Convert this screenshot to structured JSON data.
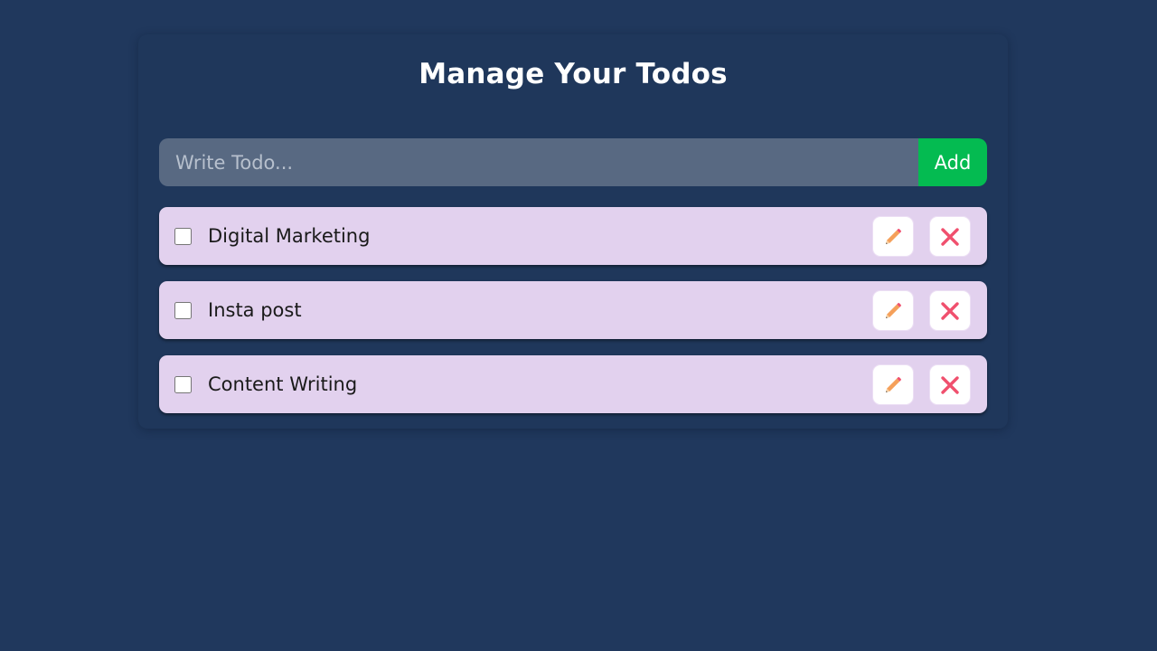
{
  "header": {
    "title": "Manage Your Todos"
  },
  "form": {
    "placeholder": "Write Todo...",
    "value": "",
    "add_label": "Add"
  },
  "todos": [
    {
      "text": "Digital Marketing",
      "completed": false
    },
    {
      "text": "Insta post",
      "completed": false
    },
    {
      "text": "Content Writing",
      "completed": false
    }
  ],
  "icons": {
    "edit": "pencil-icon",
    "delete": "close-icon"
  },
  "colors": {
    "background": "#20385d",
    "input_bg": "#586982",
    "add_button": "#04bb51",
    "todo_bg": "#e2d1ee",
    "edit_icon": "#f5a05a",
    "delete_icon": "#f0506e"
  }
}
